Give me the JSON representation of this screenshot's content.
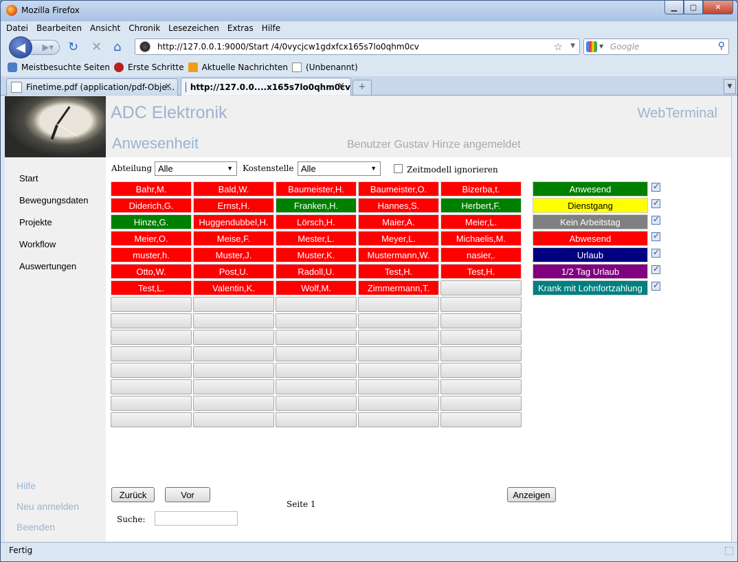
{
  "window": {
    "title": "Mozilla Firefox"
  },
  "menu": [
    "Datei",
    "Bearbeiten",
    "Ansicht",
    "Chronik",
    "Lesezeichen",
    "Extras",
    "Hilfe"
  ],
  "nav": {
    "url": "http://127.0.0.1:9000/Start /4/0vycjcw1gdxfcx165s7lo0qhm0cv",
    "search_placeholder": "Google"
  },
  "bookmarks": [
    "Meistbesuchte Seiten",
    "Erste Schritte",
    "Aktuelle Nachrichten",
    "(Unbenannt)"
  ],
  "tabs": [
    {
      "label": "Finetime.pdf (application/pdf-Obje...",
      "active": false
    },
    {
      "label": "http://127.0.0....x165s7lo0qhm0cv",
      "active": true
    }
  ],
  "header": {
    "company": "ADC Elektronik",
    "app": "WebTerminal",
    "section": "Anwesenheit",
    "user": "Benutzer Gustav Hinze angemeldet"
  },
  "sidebar": {
    "items": [
      "Start",
      "Bewegungsdaten",
      "Projekte",
      "Workflow",
      "Auswertungen"
    ],
    "bottom": [
      "Hilfe",
      "Neu anmelden",
      "Beenden"
    ]
  },
  "filters": {
    "abteilung_label": "Abteilung",
    "abteilung_value": "Alle",
    "kostenstelle_label": "Kostenstelle",
    "kostenstelle_value": "Alle",
    "zeitmodell_label": "Zeitmodell ignorieren"
  },
  "employees": [
    [
      "Bahr,M.",
      "Bald,W.",
      "Baumeister,H.",
      "Baumeister,O.",
      "Bizerba,t."
    ],
    [
      "Diderich,G.",
      "Ernst,H.",
      "Franken,H.",
      "Hannes,S.",
      "Herbert,F."
    ],
    [
      "Hinze,G.",
      "Huggendubbel,H.",
      "Lörsch,H.",
      "Maier,A.",
      "Meier,L."
    ],
    [
      "Meier,O.",
      "Meise,F.",
      "Mester,L.",
      "Meyer,L.",
      "Michaelis,M."
    ],
    [
      "muster,h.",
      "Muster,J.",
      "Muster,K.",
      "Mustermann,W.",
      "nasier,."
    ],
    [
      "Otto,W.",
      "Post,U.",
      "Radoll,U.",
      "Test,H.",
      "Test,H."
    ],
    [
      "Test,L.",
      "Valentin,K.",
      "Wolf,M.",
      "Zimmermann,T.",
      ""
    ]
  ],
  "employee_status": [
    [
      "red",
      "red",
      "red",
      "red",
      "red"
    ],
    [
      "red",
      "red",
      "green",
      "red",
      "green"
    ],
    [
      "green",
      "red",
      "red",
      "red",
      "red"
    ],
    [
      "red",
      "red",
      "red",
      "red",
      "red"
    ],
    [
      "red",
      "red",
      "red",
      "red",
      "red"
    ],
    [
      "red",
      "red",
      "red",
      "red",
      "red"
    ],
    [
      "red",
      "red",
      "red",
      "red",
      "empty"
    ]
  ],
  "legend": [
    {
      "label": "Anwesend",
      "bg": "#008000",
      "fg": "#ffffff",
      "checked": true
    },
    {
      "label": "Dienstgang",
      "bg": "#ffff00",
      "fg": "#000000",
      "checked": true
    },
    {
      "label": "Kein Arbeitstag",
      "bg": "#808080",
      "fg": "#ffffff",
      "checked": true
    },
    {
      "label": "Abwesend",
      "bg": "#ff0000",
      "fg": "#ffffff",
      "checked": true
    },
    {
      "label": "Urlaub",
      "bg": "#000080",
      "fg": "#ffffff",
      "checked": true
    },
    {
      "label": "1/2 Tag Urlaub",
      "bg": "#800080",
      "fg": "#ffffff",
      "checked": true
    },
    {
      "label": "Krank mit Lohnfortzahlung",
      "bg": "#008080",
      "fg": "#ffffff",
      "checked": true
    }
  ],
  "buttons": {
    "back": "Zurück",
    "next": "Vor",
    "show": "Anzeigen"
  },
  "pager": {
    "label": "Seite 1"
  },
  "search": {
    "label": "Suche:",
    "value": ""
  },
  "status": "Fertig"
}
